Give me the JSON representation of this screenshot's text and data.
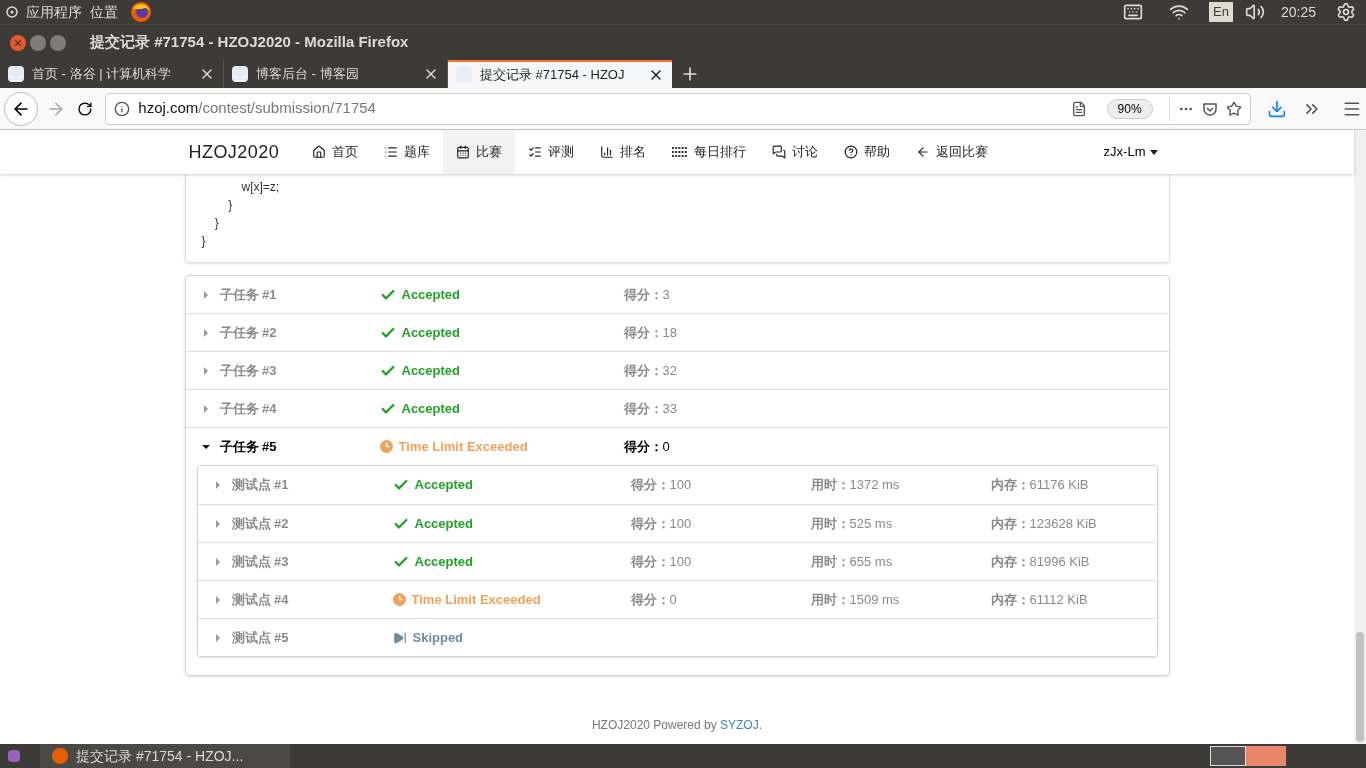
{
  "top_panel": {
    "menus": [
      "应用程序",
      "位置"
    ],
    "input_method": "En",
    "clock": "20:25"
  },
  "window": {
    "title": "提交记录 #71754 - HZOJ2020 - Mozilla Firefox"
  },
  "tabs": [
    {
      "label": "首页 - 洛谷 | 计算机科学",
      "selected": false
    },
    {
      "label": "博客后台 - 博客园",
      "selected": false
    },
    {
      "label": "提交记录 #71754 - HZOJ",
      "selected": true
    }
  ],
  "address_bar": {
    "host": "hzoj.com",
    "path": "/contest/submission/71754",
    "zoom": "90%"
  },
  "navbar": {
    "brand": "HZOJ2020",
    "items": [
      {
        "label": "首页",
        "selected": false
      },
      {
        "label": "题库",
        "selected": false
      },
      {
        "label": "比赛",
        "selected": true
      },
      {
        "label": "评测",
        "selected": false
      },
      {
        "label": "排名",
        "selected": false
      },
      {
        "label": "每日排行",
        "selected": false
      },
      {
        "label": "讨论",
        "selected": false
      },
      {
        "label": "帮助",
        "selected": false
      },
      {
        "label": "返回比赛",
        "selected": false
      }
    ],
    "user": "zJx-Lm"
  },
  "code_lines": [
    "            w[x]=z;",
    "        }",
    "    }",
    "}"
  ],
  "subtasks": [
    {
      "label": "子任务 #1",
      "status": "Accepted",
      "kind": "accepted",
      "score_label": "得分：",
      "score": "3",
      "expanded": false
    },
    {
      "label": "子任务 #2",
      "status": "Accepted",
      "kind": "accepted",
      "score_label": "得分：",
      "score": "18",
      "expanded": false
    },
    {
      "label": "子任务 #3",
      "status": "Accepted",
      "kind": "accepted",
      "score_label": "得分：",
      "score": "32",
      "expanded": false
    },
    {
      "label": "子任务 #4",
      "status": "Accepted",
      "kind": "accepted",
      "score_label": "得分：",
      "score": "33",
      "expanded": false
    },
    {
      "label": "子任务 #5",
      "status": "Time Limit Exceeded",
      "kind": "tle",
      "score_label": "得分：",
      "score": "0",
      "expanded": true,
      "testcases": [
        {
          "label": "测试点 #1",
          "status": "Accepted",
          "kind": "accepted",
          "score_label": "得分：",
          "score": "100",
          "time_label": "用时：",
          "time": "1372 ms",
          "memory_label": "内存：",
          "memory": "61176 KiB"
        },
        {
          "label": "测试点 #2",
          "status": "Accepted",
          "kind": "accepted",
          "score_label": "得分：",
          "score": "100",
          "time_label": "用时：",
          "time": "525 ms",
          "memory_label": "内存：",
          "memory": "123628 KiB"
        },
        {
          "label": "测试点 #3",
          "status": "Accepted",
          "kind": "accepted",
          "score_label": "得分：",
          "score": "100",
          "time_label": "用时：",
          "time": "655 ms",
          "memory_label": "内存：",
          "memory": "81996 KiB"
        },
        {
          "label": "测试点 #4",
          "status": "Time Limit Exceeded",
          "kind": "tle",
          "score_label": "得分：",
          "score": "0",
          "time_label": "用时：",
          "time": "1509 ms",
          "memory_label": "内存：",
          "memory": "61112 KiB"
        },
        {
          "label": "测试点 #5",
          "status": "Skipped",
          "kind": "skipped"
        }
      ]
    }
  ],
  "footer": {
    "text": "HZOJ2020 Powered by",
    "link": "SYZOJ",
    "end": "."
  },
  "taskbar": {
    "window": "提交记录 #71754 - HZOJ..."
  }
}
